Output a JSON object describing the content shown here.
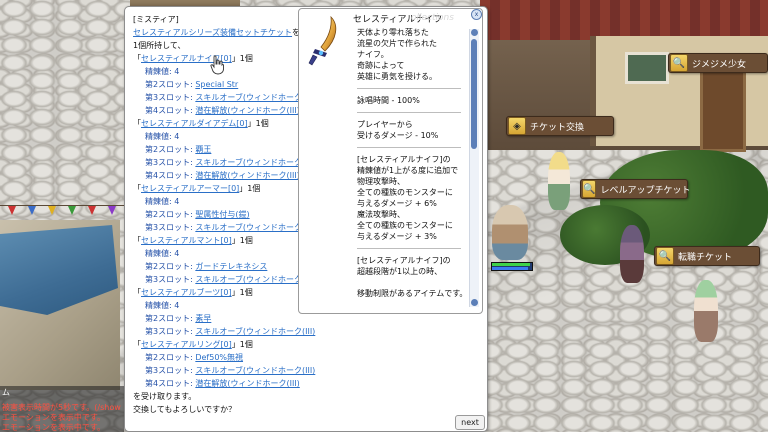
{
  "dialog": {
    "npc_name": "[ミスティア]",
    "intro_link": "セレスティアルシリーズ装備セットチケット",
    "intro_suffix": "を",
    "intro_line2": "1個所持して、",
    "refine_label": "精錬値",
    "refine_value": ": 4",
    "items": [
      {
        "open": "「",
        "name": "セレスティアルナイフ[0]",
        "qty": "」1個",
        "refine": true,
        "slots": [
          {
            "label": "第2スロット",
            "value": "Special Str"
          },
          {
            "label": "第3スロット",
            "value": "スキルオーブ(ウィンドホーク(III)"
          },
          {
            "label": "第4スロット",
            "value": "潜在解放(ウィンドホーク(III)"
          }
        ]
      },
      {
        "open": "「",
        "name": "セレスティアルダイアデム[0]",
        "qty": "」1個",
        "refine": true,
        "slots": [
          {
            "label": "第2スロット",
            "value": "覇王"
          },
          {
            "label": "第3スロット",
            "value": "スキルオーブ(ウィンドホーク(III)"
          },
          {
            "label": "第4スロット",
            "value": "潜在解放(ウィンドホーク(III)"
          }
        ]
      },
      {
        "open": "「",
        "name": "セレスティアルアーマー[0]",
        "qty": "」1個",
        "refine": true,
        "slots": [
          {
            "label": "第2スロット",
            "value": "聖属性付与(鎧)"
          },
          {
            "label": "第3スロット",
            "value": "スキルオーブ(ウィンドホーク(III)"
          }
        ]
      },
      {
        "open": "「",
        "name": "セレスティアルマント[0]",
        "qty": "」1個",
        "refine": true,
        "slots": [
          {
            "label": "第2スロット",
            "value": "ガードテレキネシス"
          },
          {
            "label": "第3スロット",
            "value": "スキルオーブ(ウィンドホーク(III)"
          }
        ]
      },
      {
        "open": "「",
        "name": "セレスティアルブーツ[0]",
        "qty": "」1個",
        "refine": true,
        "slots": [
          {
            "label": "第2スロット",
            "value": "素早"
          },
          {
            "label": "第3スロット",
            "value": "スキルオーブ(ウィンドホーク(III)"
          }
        ]
      },
      {
        "open": "「",
        "name": "セレスティアルリング[0]",
        "qty": "」1個",
        "refine": false,
        "slots": [
          {
            "label": "第2スロット",
            "value": "Def50%無視"
          },
          {
            "label": "第3スロット",
            "value": "スキルオーブ(ウィンドホーク(III)"
          },
          {
            "label": "第4スロット",
            "value": "潜在解放(ウィンドホーク(III)"
          }
        ]
      }
    ],
    "closing_line1": "を受け取ります。",
    "closing_line2": "交換してもよろしいですか？",
    "next_label": "next"
  },
  "item_popup": {
    "title": "セレスティアルナイフ",
    "watermark": "ollections",
    "close_glyph": "x",
    "lines": [
      "天体より零れ落ちた",
      "流星の欠片で作られた",
      "ナイフ。",
      "奇跡によって",
      "英雄に勇気を授ける。",
      "---",
      "詠唱時間 - 100%",
      "---",
      "プレイヤーから",
      "受けるダメージ - 10%",
      "---",
      "[セレスティアルナイフ]の",
      "精錬値が1上がる度に追加で",
      "物理攻撃時、",
      "全ての種族のモンスターに",
      "与えるダメージ + 6%",
      "魔法攻撃時、",
      "全ての種族のモンスターに",
      "与えるダメージ + 3%",
      "---",
      "[セレスティアルナイフ]の",
      "超越段階が1以上の時、",
      "",
      "移動制限があるアイテムです。"
    ]
  },
  "npc_plates": [
    {
      "label": "ジメジメ少女",
      "icon": "magnifier-icon"
    },
    {
      "label": "チケット交換",
      "icon": "exchange-icon"
    },
    {
      "label": "レベルアップチケット",
      "icon": "magnifier-icon"
    },
    {
      "label": "転職チケット",
      "icon": "magnifier-icon"
    }
  ],
  "chat": {
    "lines": [
      "ム",
      "被害表示時間が5秒です。(/show",
      "エモーションを表示中です。",
      "エモーションを表示中です。"
    ],
    "system_color": "#ffffff",
    "alert_color": "#ff5040"
  },
  "player_status": {
    "hp_fraction": 0.95,
    "sp_fraction": 0.9
  },
  "colors": {
    "link": "#2a6fc7",
    "label_blue": "#2652a8",
    "plate_bg": "#6b4e35"
  }
}
